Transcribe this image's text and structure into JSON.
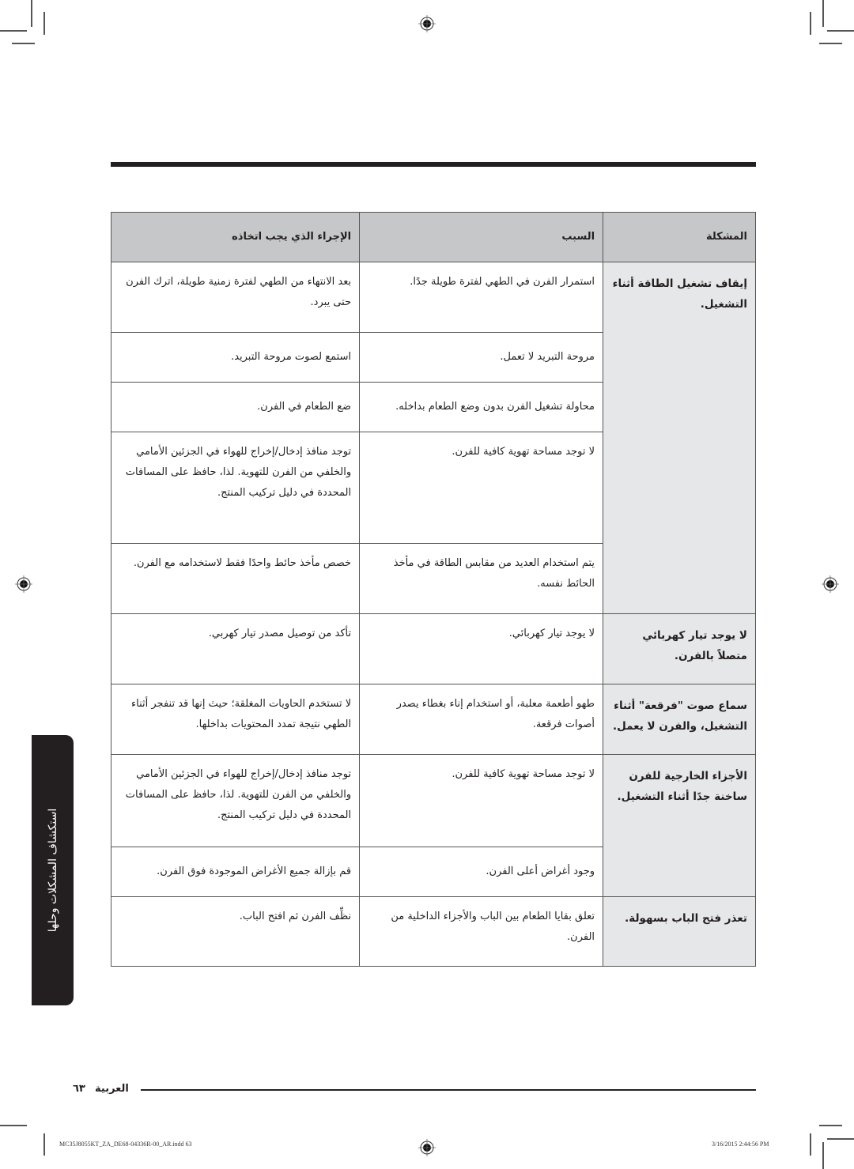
{
  "section_tab": "استكشاف المشكلات وحلها",
  "table": {
    "headers": {
      "problem": "المشكلة",
      "cause": "السبب",
      "action": "الإجراء الذي يجب اتخاذه"
    },
    "groups": [
      {
        "problem": "إيقاف تشغيل الطاقة أثناء التشغيل.",
        "rows": [
          {
            "cause": "استمرار الفرن في الطهي لفترة طويلة جدًا.",
            "action": "بعد الانتهاء من الطهي لفترة زمنية طويلة، اترك الفرن حتى يبرد."
          },
          {
            "cause": "مروحة التبريد لا تعمل.",
            "action": "استمع لصوت مروحة التبريد."
          },
          {
            "cause": "محاولة تشغيل الفرن بدون وضع الطعام بداخله.",
            "action": "ضع الطعام في الفرن."
          },
          {
            "cause": "لا توجد مساحة تهوية كافية للفرن.",
            "action": "توجد منافذ إدخال/إخراج للهواء في الجزئين الأمامي والخلفي من الفرن للتهوية. لذا، حافظ على المسافات المحددة في دليل تركيب المنتج."
          },
          {
            "cause": "يتم استخدام العديد من مقابس الطاقة في مأخذ الحائط نفسه.",
            "action": "خصص مأخذ حائط واحدًا فقط لاستخدامه مع الفرن."
          }
        ]
      },
      {
        "problem": "لا يوجد تيار كهربائي متصلاً بالفرن.",
        "rows": [
          {
            "cause": "لا يوجد تيار كهربائي.",
            "action": "تأكد من توصيل مصدر تيار كهربي."
          }
        ]
      },
      {
        "problem": "سماع صوت \"فرقعة\" أثناء التشغيل، والفرن لا يعمل.",
        "rows": [
          {
            "cause": "طهو أطعمة معلبة، أو استخدام إناء بغطاء يصدر أصوات فرقعة.",
            "action": "لا تستخدم الحاويات المغلقة؛ حيث إنها قد تنفجر أثناء الطهي نتيجة تمدد المحتويات بداخلها."
          }
        ]
      },
      {
        "problem": "الأجزاء الخارجية للفرن ساخنة جدًا أثناء التشغيل.",
        "rows": [
          {
            "cause": "لا توجد مساحة تهوية كافية للفرن.",
            "action": "توجد منافذ إدخال/إخراج للهواء في الجزئين الأمامي والخلفي من الفرن للتهوية. لذا، حافظ على المسافات المحددة في دليل تركيب المنتج."
          },
          {
            "cause": "وجود أغراض أعلى الفرن.",
            "action": "قم بإزالة جميع الأغراض الموجودة فوق الفرن."
          }
        ]
      },
      {
        "problem": "تعذر فتح الباب بسهولة.",
        "rows": [
          {
            "cause": "تعلق بقايا الطعام بين الباب والأجزاء الداخلية من الفرن.",
            "action": "نظِّف الفرن ثم افتح الباب."
          }
        ]
      }
    ]
  },
  "footer": {
    "language": "العربية",
    "page_number": "٦٣"
  },
  "slug": {
    "file": "MC35J8055KT_ZA_DE68-04336R-00_AR.indd   63",
    "timestamp": "3/16/2015   2:44:56 PM"
  },
  "icons": {
    "registration": "registration-mark-icon"
  }
}
